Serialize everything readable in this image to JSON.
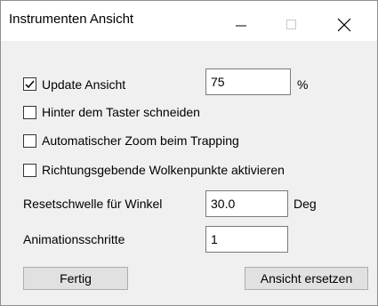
{
  "window": {
    "title": "Instrumenten Ansicht",
    "controls": {
      "minimize_icon": "minimize-icon",
      "maximize_icon": "maximize-icon",
      "close_icon": "close-icon"
    }
  },
  "options": {
    "update_view": {
      "label": "Update Ansicht",
      "checked": true,
      "value": "75",
      "unit": "%"
    },
    "clip_behind": {
      "label": "Hinter dem Taster schneiden",
      "checked": false
    },
    "auto_zoom": {
      "label": "Automatischer Zoom beim Trapping",
      "checked": false
    },
    "direction_points": {
      "label": "Richtungsgebende Wolkenpunkte aktivieren",
      "checked": false
    }
  },
  "fields": {
    "reset_threshold": {
      "label": "Resetschwelle für Winkel",
      "value": "30.0",
      "unit": "Deg"
    },
    "animation_steps": {
      "label": "Animationsschritte",
      "value": "1"
    }
  },
  "buttons": {
    "done": "Fertig",
    "replace_view": "Ansicht ersetzen"
  }
}
